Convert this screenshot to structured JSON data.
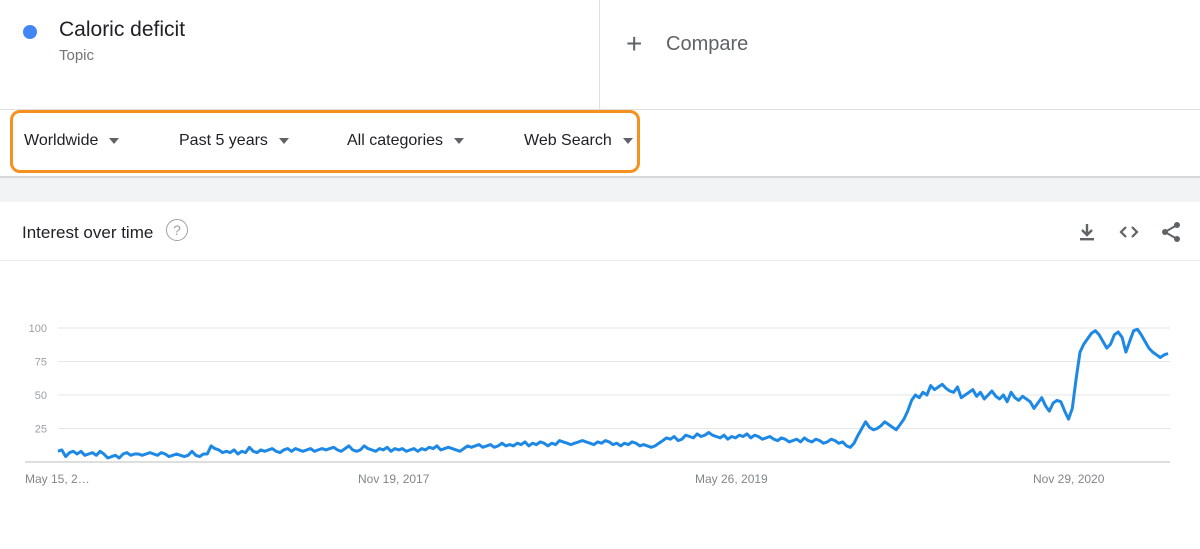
{
  "term": {
    "name": "Caloric deficit",
    "type": "Topic",
    "color": "#4285f4"
  },
  "compare": {
    "label": "Compare",
    "icon": "plus-icon"
  },
  "filters": [
    {
      "label": "Worldwide"
    },
    {
      "label": "Past 5 years"
    },
    {
      "label": "All categories"
    },
    {
      "label": "Web Search"
    }
  ],
  "highlight_color": "#f6901e",
  "card": {
    "title": "Interest over time",
    "help_icon": "question-circle-icon",
    "tools": [
      "download-icon",
      "embed-code-icon",
      "share-icon"
    ]
  },
  "chart_data": {
    "type": "line",
    "title": "",
    "xlabel": "",
    "ylabel": "",
    "ylim": [
      0,
      100
    ],
    "y_ticks": [
      25,
      50,
      75,
      100
    ],
    "x_tick_labels": [
      "May 15, 2…",
      "Nov 19, 2017",
      "May 26, 2019",
      "Nov 29, 2020"
    ],
    "x_tick_index": [
      0,
      79,
      158,
      237
    ],
    "grid": true,
    "series": [
      {
        "color": "#1e88e5",
        "values": [
          8,
          9,
          4,
          7,
          8,
          6,
          8,
          5,
          6,
          7,
          5,
          8,
          6,
          3,
          4,
          5,
          3,
          6,
          7,
          5,
          6,
          6,
          5,
          6,
          7,
          6,
          5,
          7,
          6,
          4,
          5,
          6,
          5,
          4,
          5,
          8,
          5,
          4,
          6,
          6,
          12,
          10,
          9,
          7,
          8,
          7,
          9,
          6,
          8,
          7,
          11,
          8,
          7,
          9,
          8,
          9,
          10,
          8,
          7,
          9,
          10,
          8,
          10,
          9,
          8,
          9,
          10,
          8,
          9,
          10,
          9,
          10,
          11,
          9,
          8,
          10,
          12,
          9,
          8,
          9,
          12,
          10,
          9,
          8,
          10,
          9,
          11,
          8,
          10,
          9,
          10,
          8,
          9,
          10,
          8,
          10,
          9,
          11,
          10,
          12,
          9,
          10,
          11,
          10,
          9,
          8,
          10,
          12,
          11,
          12,
          13,
          11,
          12,
          13,
          11,
          12,
          14,
          12,
          13,
          12,
          14,
          13,
          15,
          12,
          14,
          13,
          15,
          14,
          12,
          14,
          13,
          16,
          15,
          14,
          13,
          14,
          15,
          16,
          15,
          14,
          13,
          15,
          14,
          16,
          15,
          13,
          14,
          12,
          14,
          13,
          15,
          14,
          12,
          13,
          12,
          11,
          12,
          14,
          16,
          18,
          17,
          19,
          16,
          17,
          20,
          19,
          18,
          21,
          19,
          20,
          22,
          20,
          19,
          18,
          20,
          17,
          19,
          18,
          20,
          19,
          21,
          18,
          20,
          19,
          17,
          18,
          19,
          17,
          16,
          18,
          17,
          15,
          16,
          17,
          15,
          18,
          16,
          15,
          17,
          16,
          14,
          15,
          17,
          16,
          14,
          15,
          12,
          11,
          14,
          20,
          25,
          30,
          26,
          24,
          25,
          27,
          30,
          28,
          26,
          24,
          28,
          32,
          38,
          46,
          50,
          48,
          52,
          50,
          57,
          54,
          56,
          58,
          55,
          53,
          52,
          56,
          48,
          50,
          52,
          54,
          49,
          52,
          47,
          50,
          53,
          49,
          47,
          50,
          45,
          52,
          48,
          46,
          49,
          47,
          45,
          40,
          44,
          48,
          42,
          38,
          44,
          46,
          45,
          38,
          32,
          40,
          62,
          82,
          88,
          92,
          96,
          98,
          95,
          90,
          85,
          88,
          95,
          97,
          93,
          82,
          90,
          98,
          99,
          95,
          90,
          85,
          82,
          80,
          78,
          80,
          81
        ]
      }
    ]
  }
}
